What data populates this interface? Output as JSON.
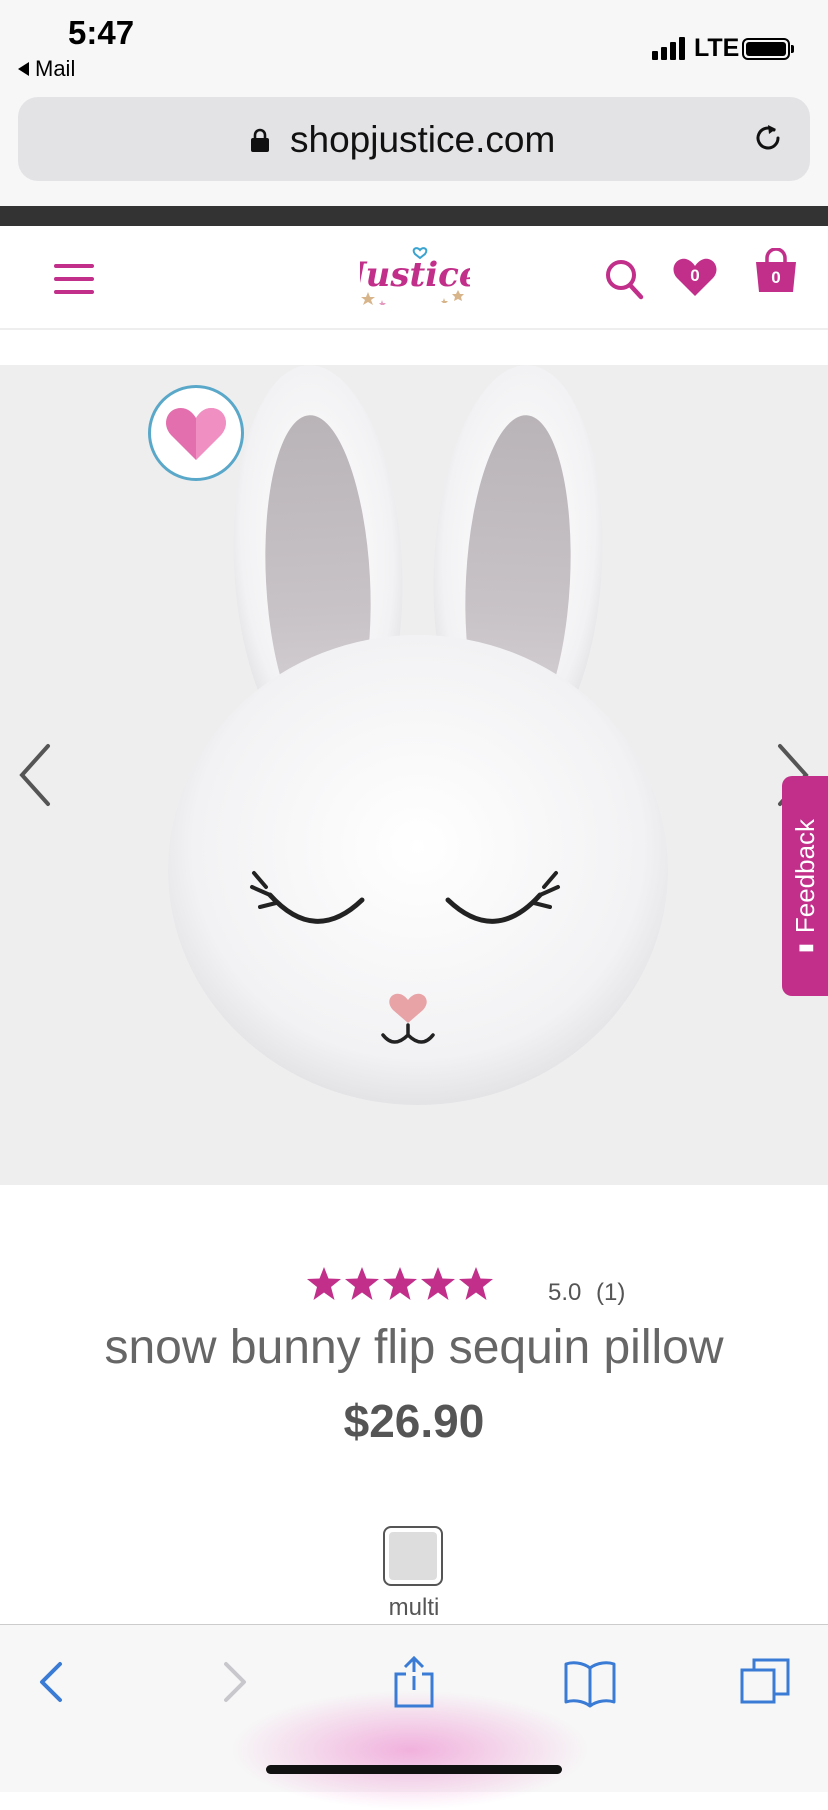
{
  "status_bar": {
    "time": "5:47",
    "back_app": "Mail",
    "network": "LTE"
  },
  "browser": {
    "url": "shopjustice.com"
  },
  "header": {
    "brand": "Justice",
    "wishlist_count": "0",
    "bag_count": "0"
  },
  "feedback": {
    "label": "Feedback"
  },
  "product": {
    "rating_value": "5.0",
    "review_count": "(1)",
    "stars": 5,
    "name": "snow bunny flip sequin pillow",
    "price": "$26.90",
    "color_label": "multi"
  },
  "colors": {
    "brand_pink": "#c12f8a",
    "ios_blue": "#3a7bd5"
  }
}
